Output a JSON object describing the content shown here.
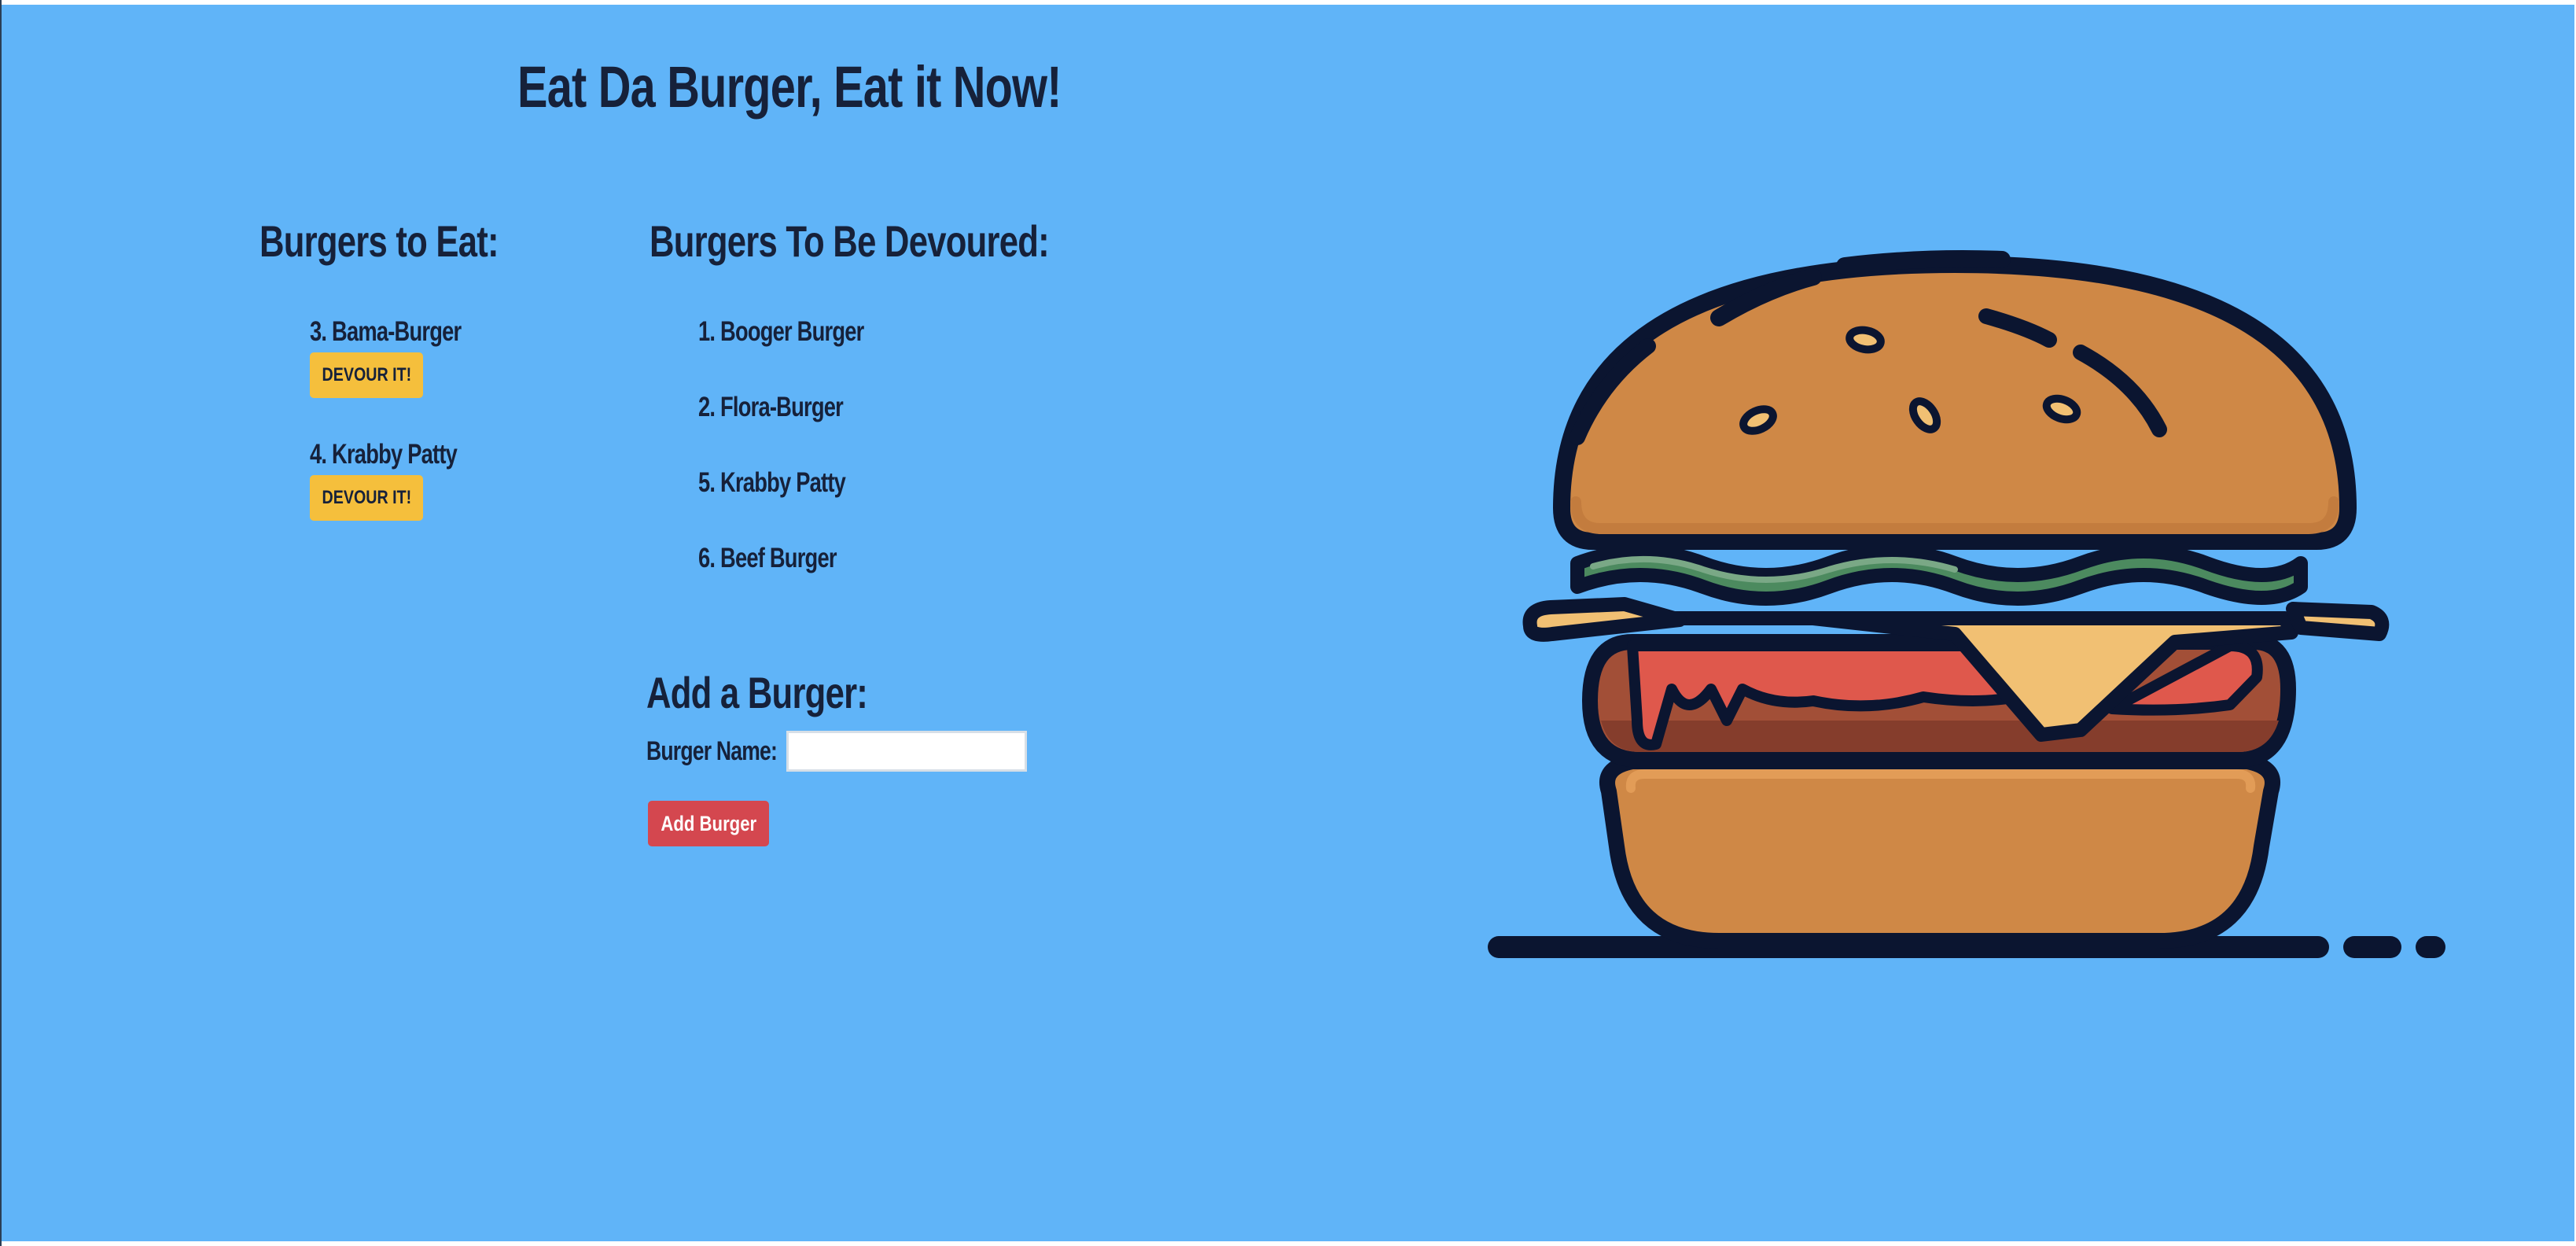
{
  "title": "Eat Da Burger, Eat it Now!",
  "to_eat": {
    "heading": "Burgers to Eat:",
    "items": [
      {
        "label": "3. Bama-Burger",
        "button": "DEVOUR IT!"
      },
      {
        "label": "4. Krabby Patty",
        "button": "DEVOUR IT!"
      }
    ]
  },
  "devoured": {
    "heading": "Burgers To Be Devoured:",
    "items": [
      {
        "label": "1. Booger Burger"
      },
      {
        "label": "2. Flora-Burger"
      },
      {
        "label": "5. Krabby Patty"
      },
      {
        "label": "6. Beef Burger"
      }
    ]
  },
  "add_form": {
    "heading": "Add a Burger:",
    "name_label": "Burger Name:",
    "name_value": "",
    "submit_label": "Add Burger"
  },
  "illustration": {
    "icon": "hamburger-illustration"
  },
  "colors": {
    "background": "#60b4f8",
    "text": "#16213a",
    "devour_button": "#f5bf3c",
    "add_button": "#d4474f"
  }
}
